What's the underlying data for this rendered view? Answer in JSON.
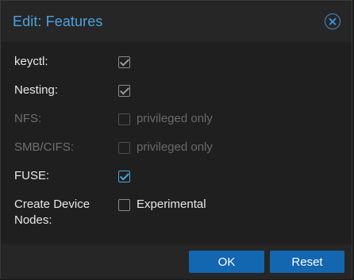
{
  "dialog": {
    "title": "Edit: Features"
  },
  "fields": [
    {
      "label": "keyctl:",
      "checked": true,
      "enabled": false,
      "note": ""
    },
    {
      "label": "Nesting:",
      "checked": true,
      "enabled": false,
      "note": ""
    },
    {
      "label": "NFS:",
      "checked": false,
      "enabled": false,
      "note": "privileged only"
    },
    {
      "label": "SMB/CIFS:",
      "checked": false,
      "enabled": false,
      "note": "privileged only"
    },
    {
      "label": "FUSE:",
      "checked": true,
      "enabled": true,
      "note": ""
    },
    {
      "label": "Create Device Nodes:",
      "checked": false,
      "enabled": true,
      "note": "Experimental"
    }
  ],
  "buttons": {
    "ok": "OK",
    "reset": "Reset"
  },
  "colors": {
    "accent": "#4aa3df",
    "button": "#1366b0"
  }
}
